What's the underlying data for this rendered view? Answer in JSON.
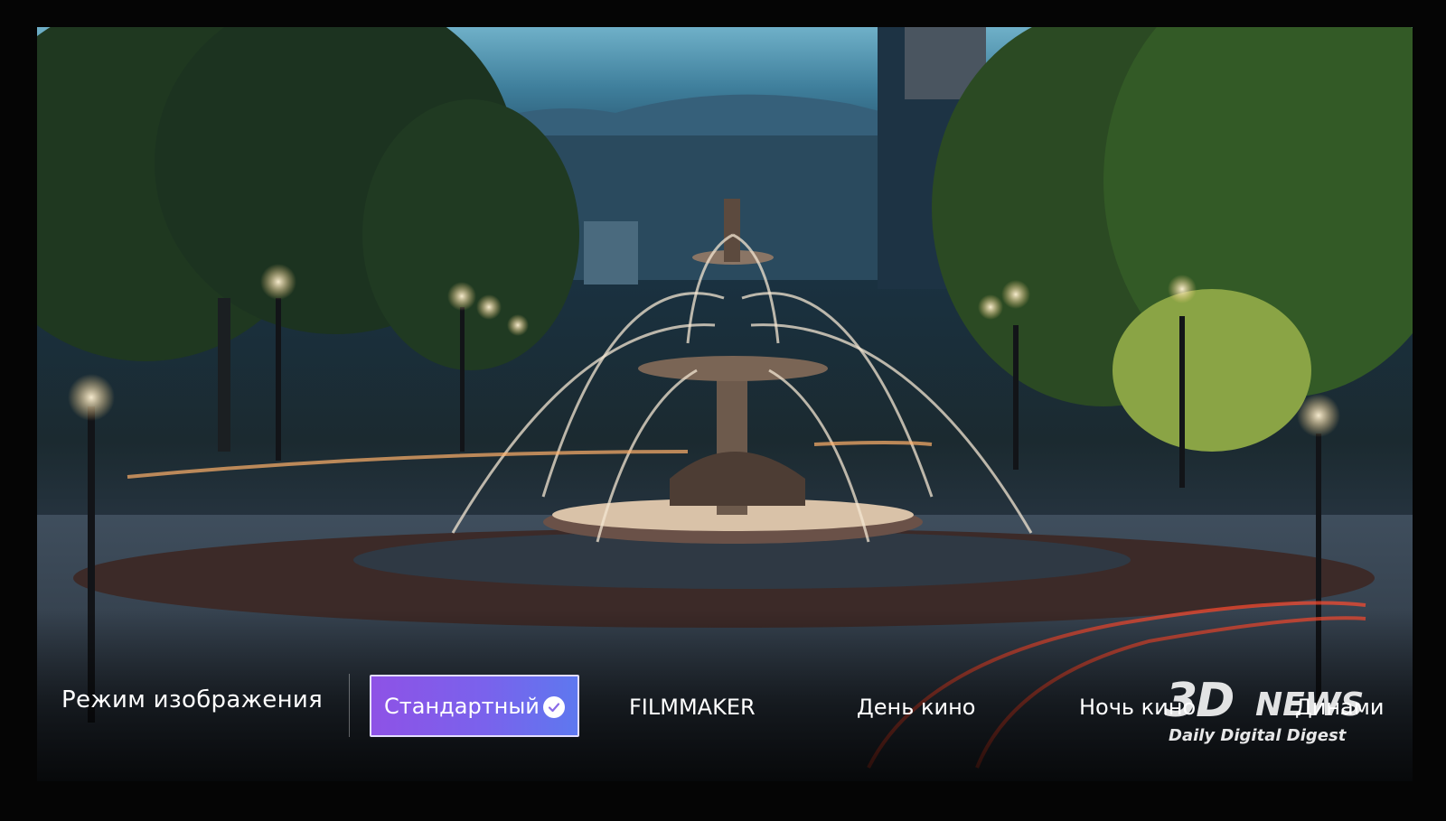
{
  "menu": {
    "title": "Режим изображения",
    "options": [
      {
        "label": "Стандартный",
        "selected": true
      },
      {
        "label": "FILMMAKER",
        "selected": false
      },
      {
        "label": "День кино",
        "selected": false
      },
      {
        "label": "Ночь кино",
        "selected": false
      },
      {
        "label": "Динами",
        "selected": false
      }
    ]
  },
  "watermark": {
    "logo": "3D",
    "brand": "NEWS",
    "tagline": "Daily Digital Digest"
  },
  "colors": {
    "selected_gradient_start": "#8e52e6",
    "selected_gradient_end": "#5e78ef",
    "text": "#ffffff"
  },
  "icons": {
    "selected_check": "check-circle-icon"
  }
}
